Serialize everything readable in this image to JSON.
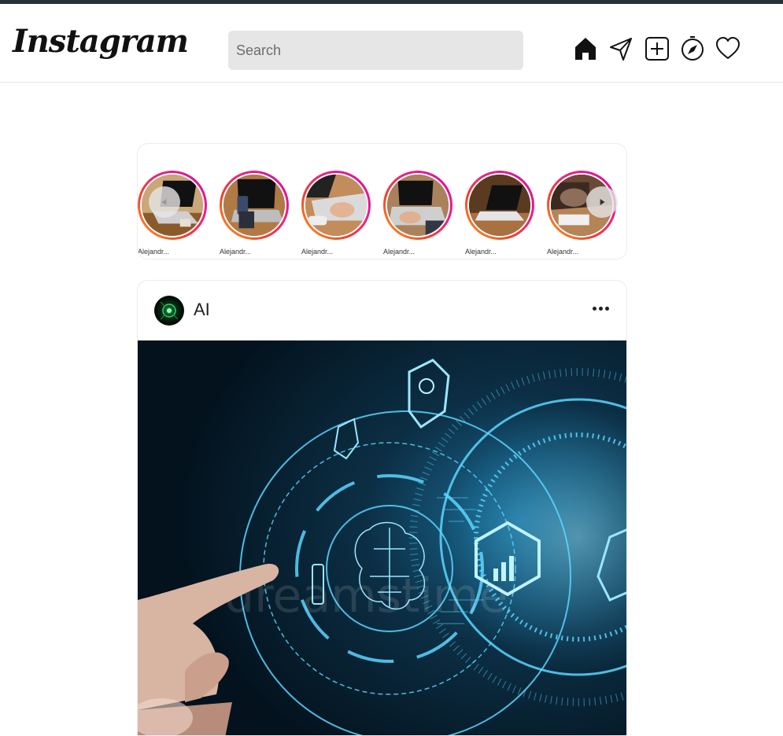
{
  "header": {
    "logo_text": "Instagram",
    "search": {
      "placeholder": "Search",
      "value": ""
    },
    "nav_icons": [
      "home-icon",
      "send-icon",
      "add-post-icon",
      "explore-icon",
      "heart-icon"
    ]
  },
  "stories": {
    "items": [
      {
        "username": "Alejandr...",
        "icon": "play-overlay"
      },
      {
        "username": "Alejandr..."
      },
      {
        "username": "Alejandr..."
      },
      {
        "username": "Alejandr..."
      },
      {
        "username": "Alejandr..."
      },
      {
        "username": "Alejandr..."
      }
    ],
    "ring_colors": [
      "#f9a825",
      "#f1422b",
      "#e91e8c"
    ]
  },
  "post": {
    "username": "AI",
    "more_icon": "more-horizontal-icon",
    "image_watermark": "dreamstime"
  },
  "colors": {
    "top_strip": "#263238",
    "search_bg": "#e6e6e6",
    "post_image_glow": "#5ad6ff"
  }
}
